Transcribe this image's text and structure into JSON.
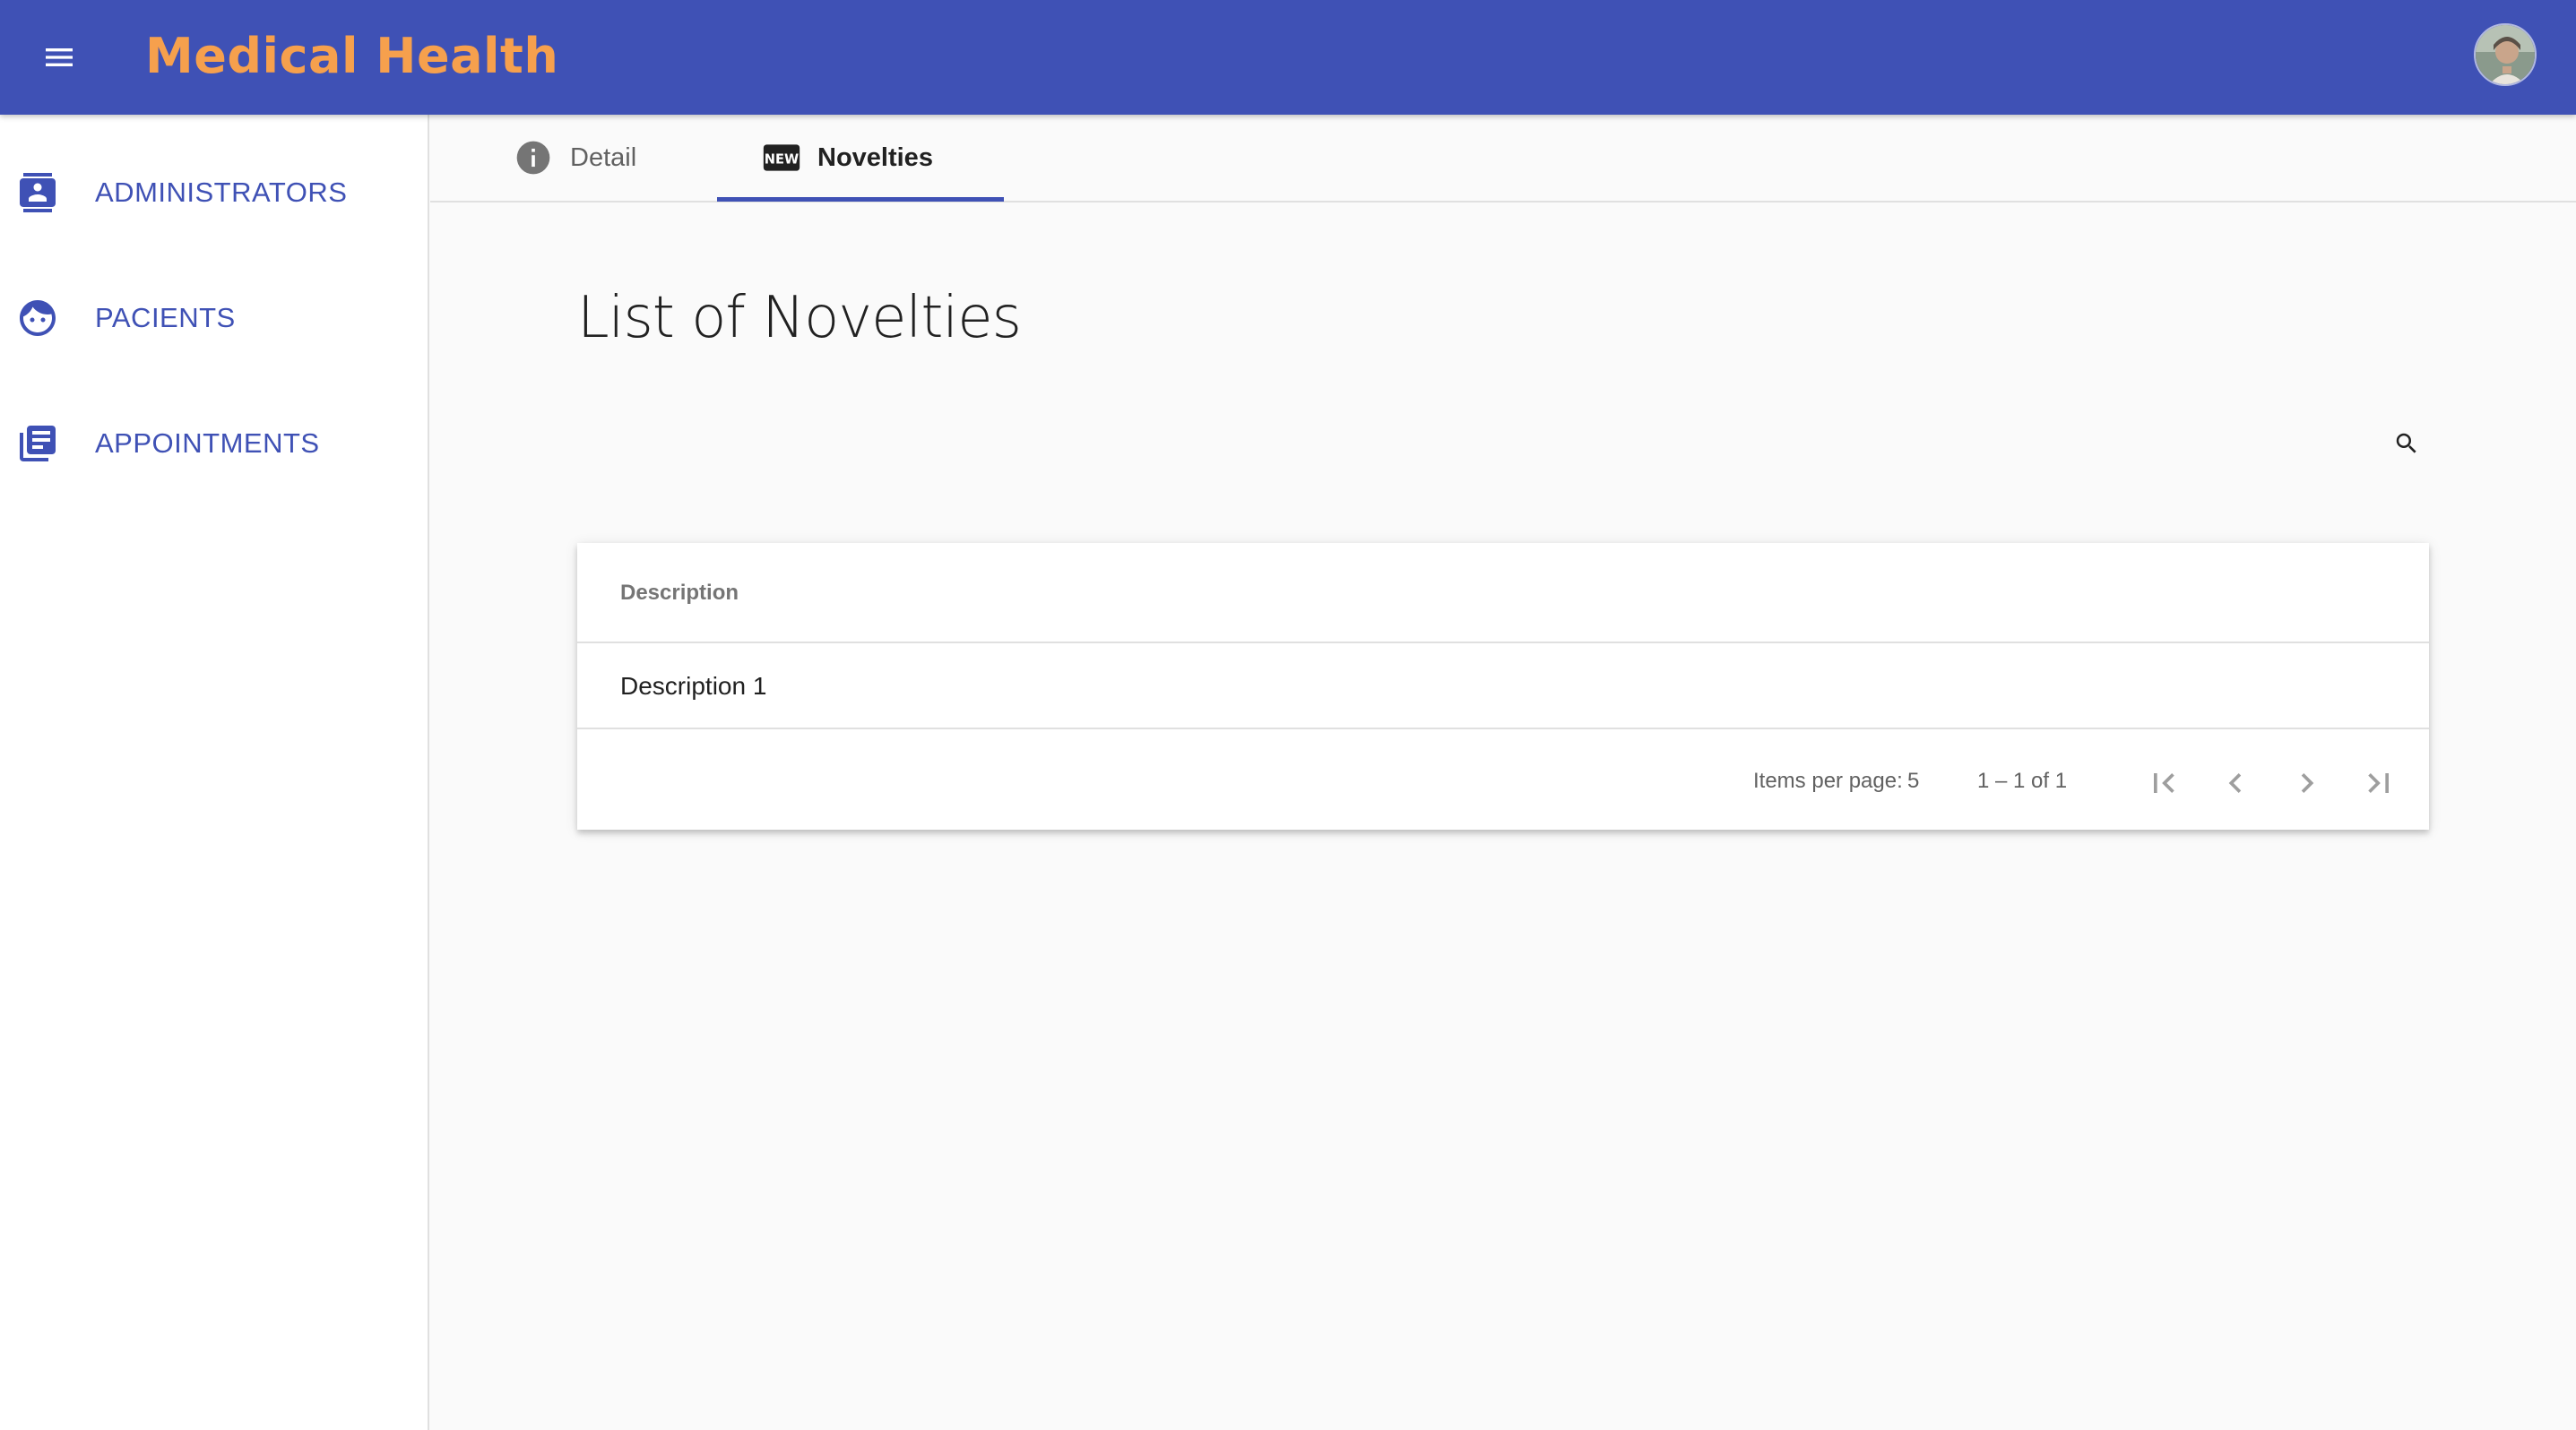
{
  "app": {
    "title": "Medical Health",
    "brand_color": "#3f51b5",
    "title_color": "#f6a04d"
  },
  "toolbar": {
    "menu_icon": "menu-icon",
    "avatar_icon": "user-avatar"
  },
  "sidebar": {
    "items": [
      {
        "label": "ADMINISTRATORS",
        "icon": "contact-card-icon"
      },
      {
        "label": "PACIENTS",
        "icon": "face-icon"
      },
      {
        "label": "APPOINTMENTS",
        "icon": "library-books-icon"
      }
    ]
  },
  "tabs": [
    {
      "label": "Detail",
      "icon": "info-icon",
      "active": false
    },
    {
      "label": "Novelties",
      "icon": "new-releases-icon",
      "active": true
    }
  ],
  "main": {
    "title": "List of Novelties",
    "search_icon": "search-icon"
  },
  "table": {
    "columns": [
      "Description"
    ],
    "rows": [
      [
        "Description 1"
      ]
    ]
  },
  "paginator": {
    "items_per_page_label": "Items per page:",
    "page_size": "5",
    "range": "1 – 1 of 1",
    "icons": [
      "first-page-icon",
      "previous-page-icon",
      "next-page-icon",
      "last-page-icon"
    ]
  }
}
